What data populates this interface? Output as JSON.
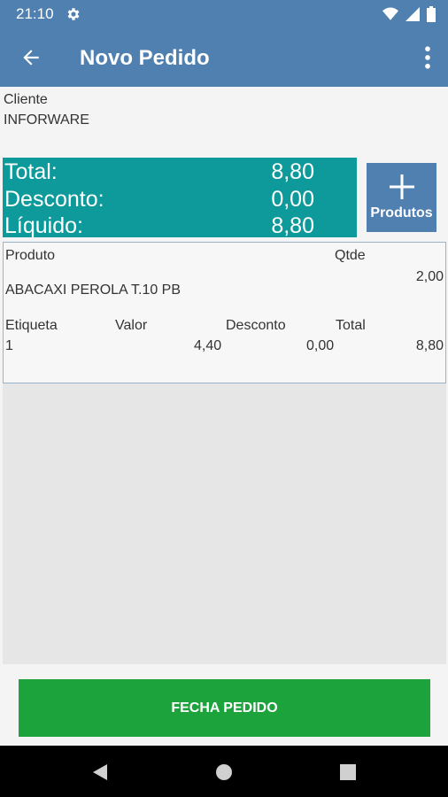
{
  "status_bar": {
    "time": "21:10",
    "icons": [
      "settings-gear-icon",
      "wifi-icon",
      "signal-icon",
      "battery-icon"
    ]
  },
  "app_bar": {
    "title": "Novo Pedido",
    "back_icon": "arrow-back-icon",
    "menu_icon": "more-vert-icon"
  },
  "cliente": {
    "label": "Cliente",
    "value": "INFORWARE"
  },
  "totals": {
    "total_label": "Total:",
    "total_value": "8,80",
    "desconto_label": "Desconto:",
    "desconto_value": "0,00",
    "liquido_label": "Líquido:",
    "liquido_value": "8,80"
  },
  "produtos_button": {
    "label": "Produtos",
    "icon": "plus-icon"
  },
  "items": [
    {
      "produto_header": "Produto",
      "qtde_header": "Qtde",
      "qtde_value": "2,00",
      "produto_name": "ABACAXI PEROLA T.10 PB",
      "etiqueta_header": "Etiqueta",
      "valor_header": "Valor",
      "desconto_header": "Desconto",
      "total_header": "Total",
      "etiqueta_value": "1",
      "valor_value": "4,40",
      "desconto_value": "0,00",
      "total_value": "8,80"
    }
  ],
  "footer_button": {
    "label": "FECHA PEDIDO"
  },
  "colors": {
    "primary": "#4f80b0",
    "totals_bg": "#0e9a9a",
    "action_green": "#1ca33c"
  },
  "nav_bar": {
    "icons": [
      "back-triangle-icon",
      "home-circle-icon",
      "recents-square-icon"
    ]
  }
}
